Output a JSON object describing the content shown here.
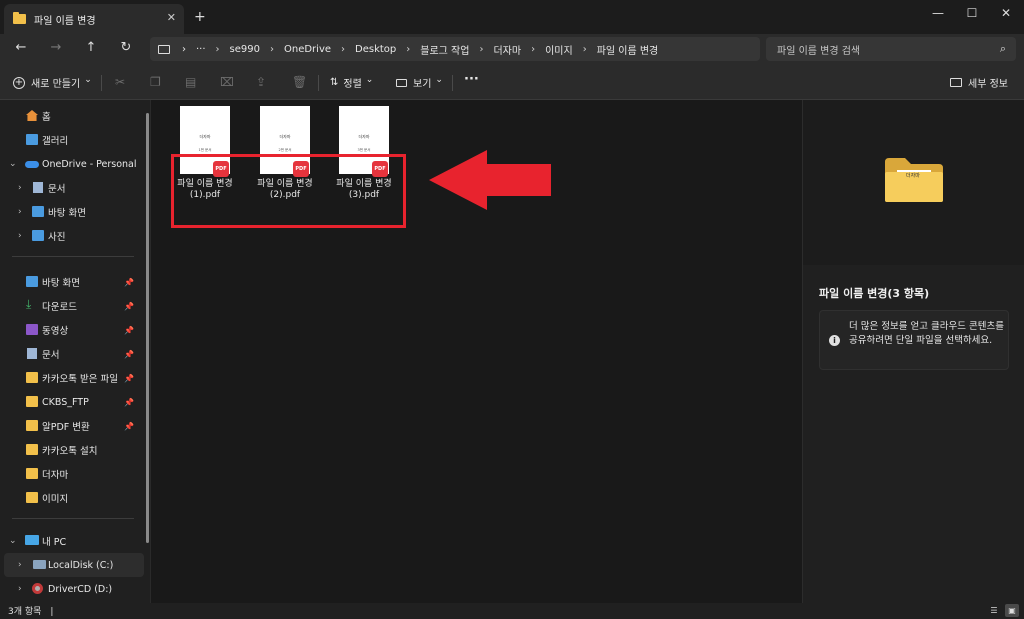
{
  "window": {
    "tab_title": "파일 이름 변경",
    "tab_close": "✕",
    "new_tab": "+",
    "minimize": "—",
    "maximize": "☐",
    "close": "✕"
  },
  "nav": {
    "back": "←",
    "forward": "→",
    "up": "↑",
    "refresh": "↻"
  },
  "breadcrumb": {
    "more": "···",
    "separator": "›",
    "items": [
      "se990",
      "OneDrive",
      "Desktop",
      "블로그 작업",
      "더자마",
      "이미지",
      "파일 이름 변경"
    ]
  },
  "search": {
    "placeholder": "파일 이름 변경 검색",
    "icon": "⌕"
  },
  "toolbar": {
    "new_label": "새로 만들기",
    "sort_label": "정렬",
    "view_label": "보기",
    "more": "···",
    "details_label": "세부 정보",
    "dropdown": "⌄"
  },
  "sidebar": {
    "home": "홈",
    "gallery": "갤러리",
    "onedrive": "OneDrive - Personal",
    "od_documents": "문서",
    "od_desktop": "바탕 화면",
    "od_pictures": "사진",
    "quick": [
      {
        "label": "바탕 화면",
        "pinned": true
      },
      {
        "label": "다운로드",
        "pinned": true
      },
      {
        "label": "동영상",
        "pinned": true
      },
      {
        "label": "문서",
        "pinned": true
      },
      {
        "label": "카카오톡 받은 파일",
        "pinned": true
      },
      {
        "label": "CKBS_FTP",
        "pinned": true
      },
      {
        "label": "알PDF 변환",
        "pinned": true
      },
      {
        "label": "카카오톡 설치",
        "pinned": false
      },
      {
        "label": "더자마",
        "pinned": false
      },
      {
        "label": "이미지",
        "pinned": false
      }
    ],
    "this_pc": "내 PC",
    "local_disk": "LocalDisk (C:)",
    "driver_cd": "DriverCD (D:)",
    "pin_glyph": "📌"
  },
  "files": [
    {
      "name_line1": "파일 이름 변경",
      "name_line2": "(1).pdf",
      "thumb_title": "더자마",
      "thumb_sub": "1번 문서",
      "badge": "PDF"
    },
    {
      "name_line1": "파일 이름 변경",
      "name_line2": "(2).pdf",
      "thumb_title": "더자마",
      "thumb_sub": "2번 문서",
      "badge": "PDF"
    },
    {
      "name_line1": "파일 이름 변경",
      "name_line2": "(3).pdf",
      "thumb_title": "더자마",
      "thumb_sub": "3번 문서",
      "badge": "PDF"
    }
  ],
  "details": {
    "folder_label": "더자마",
    "title": "파일 이름 변경(3 항목)",
    "info_icon": "i",
    "info_text": "더 많은 정보를 얻고 클라우드 콘텐츠를 공유하려면 단일 파일을 선택하세요."
  },
  "status": {
    "item_count": "3개 항목",
    "cursor": "|"
  },
  "colors": {
    "highlight": "#e8232e",
    "folder": "#f2c04a",
    "pdf_badge": "#e5343d"
  }
}
